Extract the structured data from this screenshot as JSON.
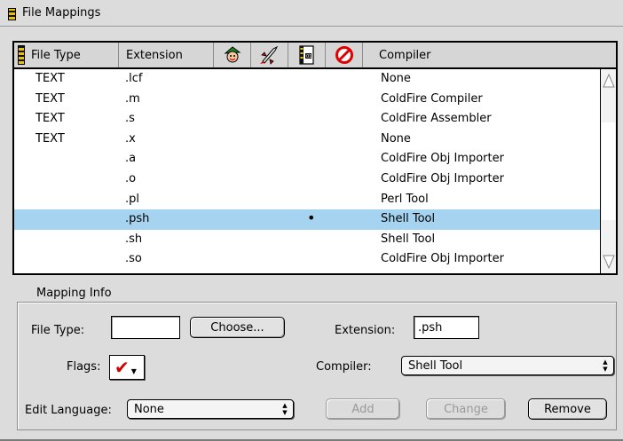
{
  "window": {
    "title": "File Mappings",
    "icon": "stripe-icon"
  },
  "table": {
    "headers": {
      "file_type": "File Type",
      "extension": "Extension",
      "flag_icons": [
        "elf-icon",
        "rocket-icon",
        "doc-icon",
        "prohibit-icon"
      ],
      "compiler": "Compiler"
    },
    "rows": [
      {
        "file_type": "TEXT",
        "extension": ".lcf",
        "flag": "",
        "compiler": "None"
      },
      {
        "file_type": "TEXT",
        "extension": ".m",
        "flag": "",
        "compiler": "ColdFire Compiler"
      },
      {
        "file_type": "TEXT",
        "extension": ".s",
        "flag": "",
        "compiler": "ColdFire Assembler"
      },
      {
        "file_type": "TEXT",
        "extension": ".x",
        "flag": "",
        "compiler": "None"
      },
      {
        "file_type": "",
        "extension": ".a",
        "flag": "",
        "compiler": "ColdFire Obj Importer"
      },
      {
        "file_type": "",
        "extension": ".o",
        "flag": "",
        "compiler": "ColdFire Obj Importer"
      },
      {
        "file_type": "",
        "extension": ".pl",
        "flag": "",
        "compiler": "Perl Tool"
      },
      {
        "file_type": "",
        "extension": ".psh",
        "flag": "•",
        "compiler": "Shell Tool"
      },
      {
        "file_type": "",
        "extension": ".sh",
        "flag": "",
        "compiler": "Shell Tool"
      },
      {
        "file_type": "",
        "extension": ".so",
        "flag": "",
        "compiler": "ColdFire Obj Importer"
      }
    ],
    "selected_row_index": 7
  },
  "mapping_info": {
    "legend": "Mapping Info",
    "file_type_label": "File Type:",
    "file_type_value": "",
    "choose_label": "Choose...",
    "extension_label": "Extension:",
    "extension_value": ".psh",
    "flags_label": "Flags:",
    "flags_value": "✔",
    "compiler_label": "Compiler:",
    "compiler_value": "Shell Tool",
    "edit_language_label": "Edit Language:",
    "edit_language_value": "None",
    "add_label": "Add",
    "change_label": "Change",
    "remove_label": "Remove"
  },
  "colors": {
    "selection": "#a6d3f0",
    "check": "#d10000"
  }
}
